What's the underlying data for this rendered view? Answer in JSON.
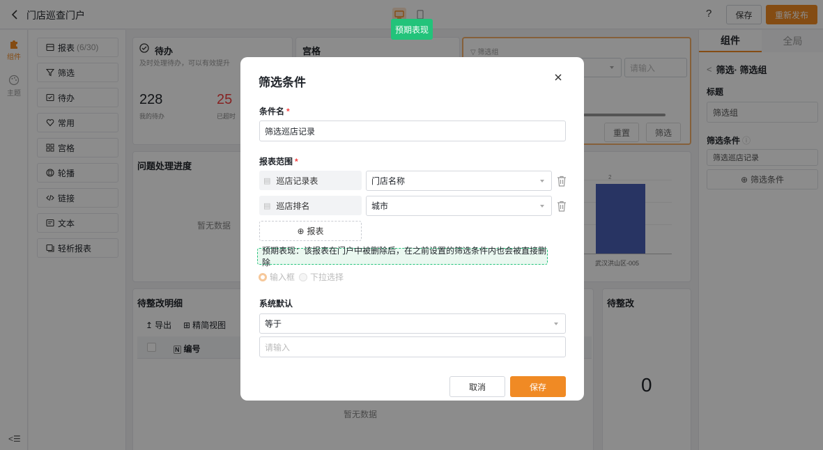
{
  "topbar": {
    "title": "门店巡查门户",
    "tooltip": "预期表现",
    "help": "?",
    "save_label": "保存",
    "publish_label": "重新发布"
  },
  "rail": {
    "components_label": "组件",
    "theme_label": "主题",
    "collapse": "<☰"
  },
  "complist": {
    "items": [
      {
        "label": "报表",
        "extra": "(6/30)",
        "icon": "report-icon"
      },
      {
        "label": "筛选",
        "icon": "filter-icon"
      },
      {
        "label": "待办",
        "icon": "todo-icon"
      },
      {
        "label": "常用",
        "icon": "heart-icon"
      },
      {
        "label": "宫格",
        "icon": "grid-icon"
      },
      {
        "label": "轮播",
        "icon": "carousel-icon"
      },
      {
        "label": "链接",
        "icon": "code-icon"
      },
      {
        "label": "文本",
        "icon": "text-icon"
      },
      {
        "label": "轻析报表",
        "icon": "light-report-icon"
      }
    ]
  },
  "canvas": {
    "todo": {
      "title": "待办",
      "subtitle": "及时处理待办，可以有效提升",
      "count1": "228",
      "count1_label": "我的待办",
      "count2": "25",
      "count2_label": "已超时"
    },
    "grid_title": "宫格",
    "filter": {
      "label": "筛选组",
      "placeholder": "请输入",
      "reset": "重置",
      "search": "筛选"
    },
    "progress": {
      "title": "问题处理进度",
      "empty": "暂无数据"
    },
    "bar": {
      "value_label": "2",
      "xlabel": "武汉洪山区-005"
    },
    "detail": {
      "title": "待整改明细",
      "export": "导出",
      "view": "精简视图",
      "col_no": "编号",
      "empty": "暂无数据"
    },
    "pending": {
      "title": "待整改",
      "value": "0"
    }
  },
  "rpanel": {
    "tab_component": "组件",
    "tab_global": "全局",
    "breadcrumb": "筛选· 筛选组",
    "title_label": "标题",
    "title_value": "筛选组",
    "cond_label": "筛选条件",
    "cond_item": "筛选巡店记录",
    "add_cond": "筛选条件"
  },
  "modal": {
    "title": "筛选条件",
    "name_label": "条件名",
    "name_value": "筛选巡店记录",
    "scope_label": "报表范围",
    "reports": [
      {
        "name": "巡店记录表",
        "field": "门店名称"
      },
      {
        "name": "巡店排名",
        "field": "城市"
      }
    ],
    "add_report": "报表",
    "note": "预期表现：该报表在门户中被删除后，在之前设置的筛选条件内也会被直接删除",
    "radio_input": "输入框",
    "radio_select": "下拉选择",
    "default_label": "系统默认",
    "operator_value": "等于",
    "default_placeholder": "请输入",
    "cancel": "取消",
    "save": "保存",
    "required_mark": "*"
  },
  "colors": {
    "accent": "#f08a24",
    "tooltip_green": "#22c37a",
    "bar_blue": "#4a5fb5",
    "danger": "#f53f3f"
  }
}
